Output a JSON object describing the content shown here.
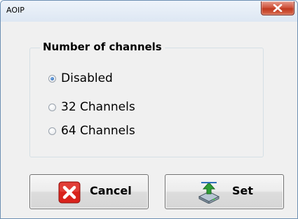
{
  "window": {
    "title": "AOIP"
  },
  "group": {
    "legend": "Number of channels",
    "options": [
      {
        "label": "Disabled",
        "checked": true
      },
      {
        "label": "32 Channels",
        "checked": false
      },
      {
        "label": "64 Channels",
        "checked": false
      }
    ]
  },
  "buttons": {
    "cancel_label": "Cancel",
    "set_label": "Set"
  },
  "colors": {
    "close_button": "#c0391f",
    "cancel_icon": "#d9231c",
    "set_arrow": "#2f9e36"
  },
  "icons": {
    "close": "close-icon",
    "cancel": "cancel-x-icon",
    "set": "drive-upload-icon"
  }
}
